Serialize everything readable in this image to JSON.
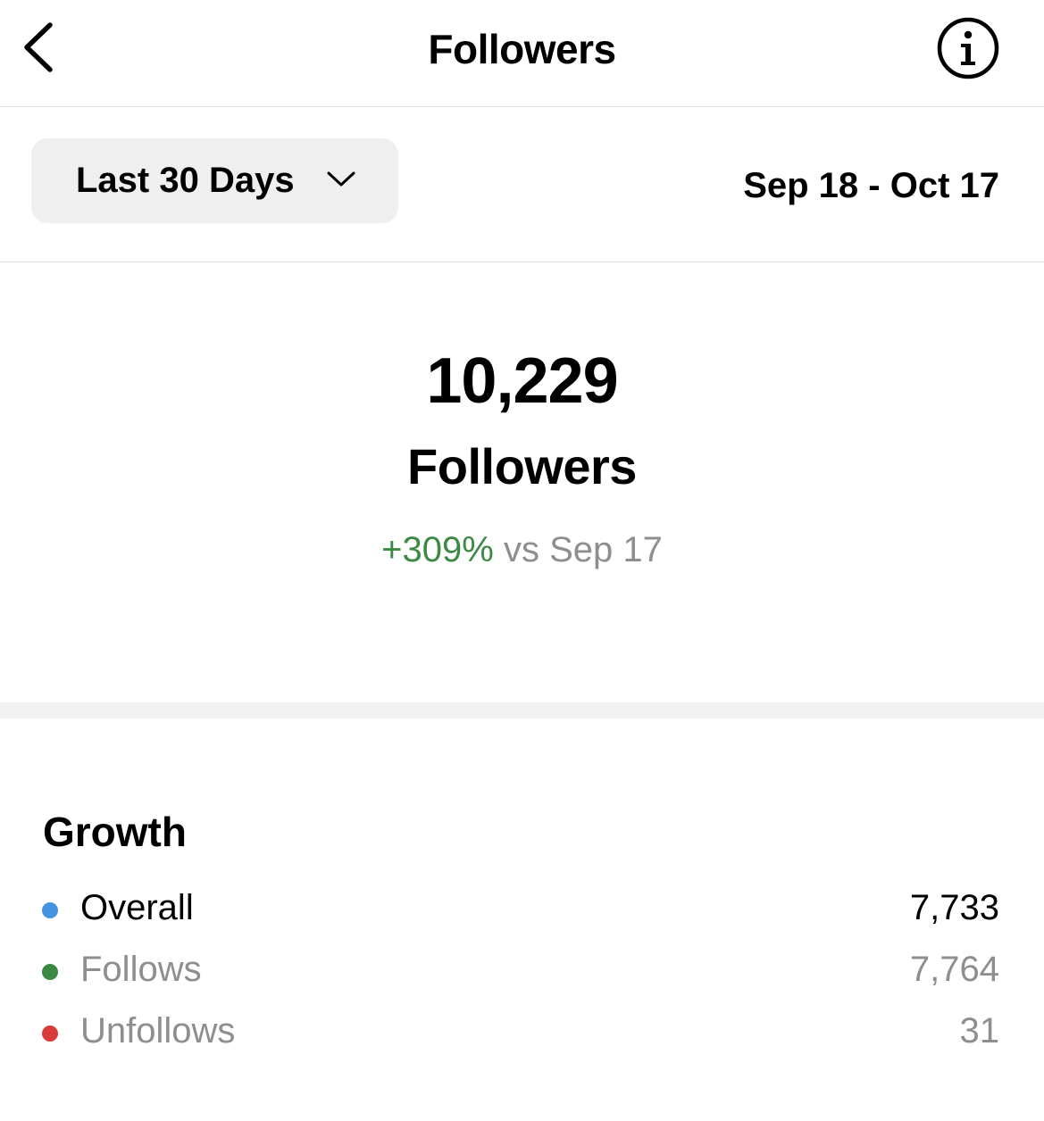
{
  "header": {
    "title": "Followers",
    "back_icon": "chevron-left-icon",
    "info_icon": "info-circle-icon"
  },
  "filter": {
    "range_label": "Last 30 Days",
    "range_icon": "chevron-down-icon",
    "date_range": "Sep 18 - Oct 17"
  },
  "summary": {
    "count": "10,229",
    "label": "Followers",
    "change_percent": "+309%",
    "change_reference": "vs Sep 17"
  },
  "growth": {
    "title": "Growth",
    "rows": [
      {
        "label": "Overall",
        "value": "7,733",
        "color": "#4592e3"
      },
      {
        "label": "Follows",
        "value": "7,764",
        "color": "#3a8a43"
      },
      {
        "label": "Unfollows",
        "value": "31",
        "color": "#d93a3a"
      }
    ]
  },
  "colors": {
    "positive": "#3d8a45",
    "muted_text": "#8e8e8e",
    "chip_background": "#efefef"
  }
}
